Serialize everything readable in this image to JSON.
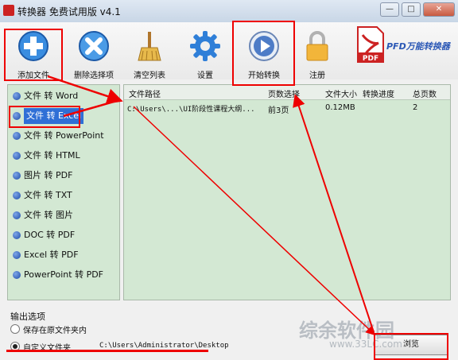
{
  "window": {
    "title": "转换器 免费试用版 v4.1",
    "min": "—",
    "max": "□",
    "close": "✕"
  },
  "toolbar": {
    "add": "添加文件",
    "remove": "删除选择项",
    "clear": "清空列表",
    "settings": "设置",
    "start": "开始转换",
    "register": "注册"
  },
  "brand": {
    "text": "PFD万能转换器",
    "logo_text": "PDF"
  },
  "sidebar": {
    "items": [
      {
        "label": "文件 转 Word"
      },
      {
        "label": "文件 转 Excel",
        "selected": true
      },
      {
        "label": "文件 转 PowerPoint"
      },
      {
        "label": "文件 转 HTML"
      },
      {
        "label": "图片 转 PDF"
      },
      {
        "label": "文件 转 TXT"
      },
      {
        "label": "文件 转 图片"
      },
      {
        "label": "DOC 转 PDF"
      },
      {
        "label": "Excel 转 PDF"
      },
      {
        "label": "PowerPoint 转 PDF"
      }
    ]
  },
  "table": {
    "headers": [
      "文件路径",
      "页数选择",
      "文件大小",
      "转换进度",
      "总页数"
    ],
    "rows": [
      {
        "path": "C:\\Users\\...\\UI阶段性课程大纲...",
        "pages": "前3页",
        "size": "0.12MB",
        "progress": "",
        "total": "2"
      }
    ]
  },
  "output": {
    "title": "输出选项",
    "opt1": "保存在原文件夹内",
    "opt2": "自定义文件夹",
    "path": "C:\\Users\\Administrator\\Desktop",
    "browse": "浏览"
  },
  "watermark": {
    "main": "综余软件园",
    "sub": "www.33LC.com"
  },
  "colors": {
    "accent": "#2f6fd6",
    "annotation": "#e00000",
    "panel": "#d3e8d3"
  }
}
